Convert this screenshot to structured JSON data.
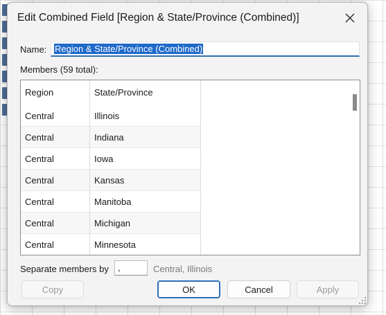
{
  "dialog": {
    "title": "Edit Combined Field [Region & State/Province (Combined)]"
  },
  "name_field": {
    "label": "Name:",
    "value": "Region & State/Province (Combined)"
  },
  "members": {
    "label": "Members (59 total):",
    "columns": [
      "Region",
      "State/Province"
    ],
    "rows": [
      [
        "Central",
        "Illinois"
      ],
      [
        "Central",
        "Indiana"
      ],
      [
        "Central",
        "Iowa"
      ],
      [
        "Central",
        "Kansas"
      ],
      [
        "Central",
        "Manitoba"
      ],
      [
        "Central",
        "Michigan"
      ],
      [
        "Central",
        "Minnesota"
      ]
    ]
  },
  "separator": {
    "label": "Separate members by",
    "value": ",",
    "example": "Central, Illinois"
  },
  "buttons": {
    "copy": "Copy",
    "ok": "OK",
    "cancel": "Cancel",
    "apply": "Apply"
  },
  "icons": {
    "close": "close-icon",
    "resize": "resize-grip-icon"
  },
  "colors": {
    "accent": "#1f69c9",
    "focus_border": "#2f6fb7",
    "dialog_bg": "#f3f3f3"
  }
}
